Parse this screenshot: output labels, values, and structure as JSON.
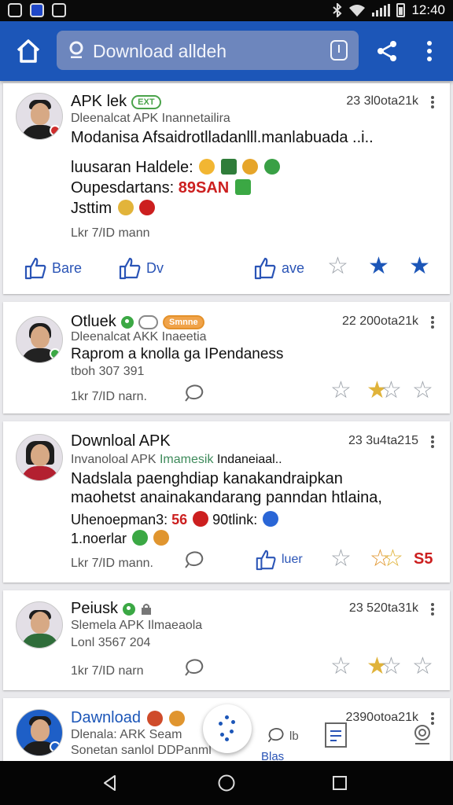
{
  "status_bar": {
    "time": "12:40"
  },
  "header": {
    "search_text": "Download alldeh"
  },
  "colors": {
    "primary": "#1c56b8",
    "green": "#3ba844",
    "orange": "#f0a34a",
    "red": "#cc1f1f"
  },
  "icons": [
    "home-icon",
    "search-icon",
    "clipboard-icon",
    "share-icon",
    "more-vertical-icon",
    "like-icon",
    "star-icon",
    "comment-icon",
    "back-icon",
    "home-nav-icon",
    "recents-icon"
  ],
  "posts": [
    {
      "name": "APK lek",
      "badge": "EXT",
      "time": "23 3l0ota21k",
      "subtitle": "Dleenalcat APK Inannetailira",
      "line1": "Modanisa Afsaidrotlladanlll.manlabuada ..i..",
      "line2": "luusaran Haldele:",
      "line3_prefix": "Oupesdartans:",
      "line3_highlight": "89SAN",
      "line4": "Jsttim",
      "meta": "Lkr 7/ID mann",
      "action1": "Bare",
      "action2": "Dv",
      "action3": "ave"
    },
    {
      "name": "Otluek",
      "badge": "Smnne",
      "time": "22 200ota21k",
      "subtitle": "Dleenalcat AKK Inaeetia",
      "line1": "Raprom a knolla ga IPendaness",
      "line2": "tboh 307 391",
      "meta": "1kr 7/ID narn."
    },
    {
      "name": "Downloal APK",
      "time": "23 3u4ta215",
      "subtitle_prefix": "Invanoloal APK",
      "subtitle_highlight": "Imamesik",
      "subtitle_suffix": "Indaneiaal..",
      "line1": "Nadslala paenghdiap kanakandraipkan",
      "line2": "maohetst anainakandarang panndan htlaina,",
      "line3_prefix": "Uhenoepman3:",
      "line3_highlight": "56",
      "line3_suffix": "90tlink:",
      "line4": "1.noerlar",
      "meta": "Lkr 7/ID mann.",
      "action": "luer",
      "rating_label": "S5"
    },
    {
      "name": "Peiusk",
      "time": "23 520ta31k",
      "subtitle": "Slemela APK Ilmaeaola",
      "line1": "Lonl 3567 204",
      "meta": "1kr 7/ID narn"
    },
    {
      "name": "Dawnload",
      "time": "2390otoa21k",
      "subtitle": "Dlenala: ARK Seam",
      "line1": "Sonetan sanlol DDPanml",
      "action": "lb",
      "action2": "Blas"
    }
  ]
}
